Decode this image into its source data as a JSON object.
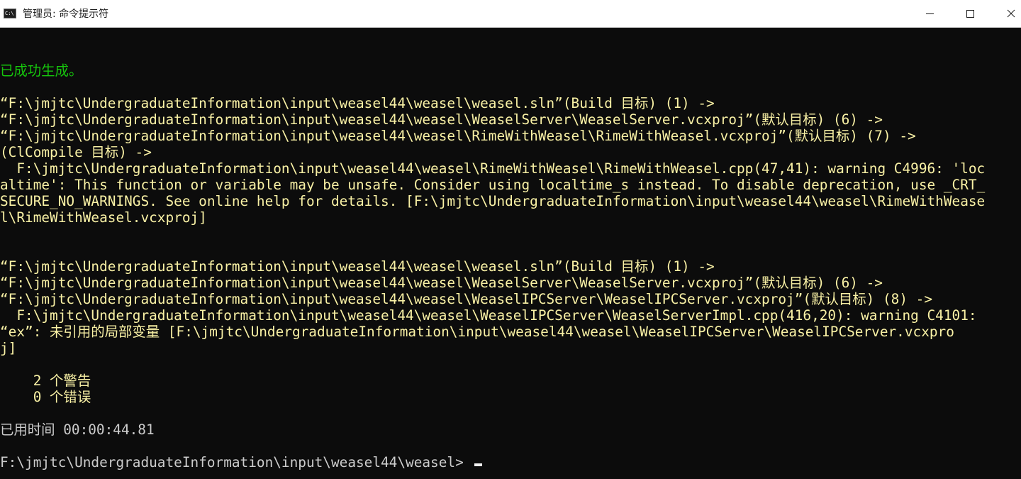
{
  "window": {
    "title": "管理员: 命令提示符",
    "icon": "cmd-icon",
    "controls": {
      "minimize": "minimize-icon",
      "maximize": "maximize-icon",
      "close": "close-icon"
    }
  },
  "colors": {
    "background": "#0c0c0c",
    "success": "#16c60c",
    "warning": "#f9f1a5",
    "default_text": "#cccccc"
  },
  "console": {
    "lines": [
      {
        "text": "已成功生成。",
        "color": "green"
      },
      {
        "text": "",
        "color": "gray"
      },
      {
        "text": "“F:\\jmjtc\\UndergraduateInformation\\input\\weasel44\\weasel\\weasel.sln”(Build 目标) (1) ->",
        "color": "yellow"
      },
      {
        "text": "“F:\\jmjtc\\UndergraduateInformation\\input\\weasel44\\weasel\\WeaselServer\\WeaselServer.vcxproj”(默认目标) (6) ->",
        "color": "yellow"
      },
      {
        "text": "“F:\\jmjtc\\UndergraduateInformation\\input\\weasel44\\weasel\\RimeWithWeasel\\RimeWithWeasel.vcxproj”(默认目标) (7) ->",
        "color": "yellow"
      },
      {
        "text": "(ClCompile 目标) ->",
        "color": "yellow"
      },
      {
        "text": "  F:\\jmjtc\\UndergraduateInformation\\input\\weasel44\\weasel\\RimeWithWeasel\\RimeWithWeasel.cpp(47,41): warning C4996: 'loc",
        "color": "yellow"
      },
      {
        "text": "altime': This function or variable may be unsafe. Consider using localtime_s instead. To disable deprecation, use _CRT_",
        "color": "yellow"
      },
      {
        "text": "SECURE_NO_WARNINGS. See online help for details. [F:\\jmjtc\\UndergraduateInformation\\input\\weasel44\\weasel\\RimeWithWease",
        "color": "yellow"
      },
      {
        "text": "l\\RimeWithWeasel.vcxproj]",
        "color": "yellow"
      },
      {
        "text": "",
        "color": "gray"
      },
      {
        "text": "",
        "color": "gray"
      },
      {
        "text": "“F:\\jmjtc\\UndergraduateInformation\\input\\weasel44\\weasel\\weasel.sln”(Build 目标) (1) ->",
        "color": "yellow"
      },
      {
        "text": "“F:\\jmjtc\\UndergraduateInformation\\input\\weasel44\\weasel\\WeaselServer\\WeaselServer.vcxproj”(默认目标) (6) ->",
        "color": "yellow"
      },
      {
        "text": "“F:\\jmjtc\\UndergraduateInformation\\input\\weasel44\\weasel\\WeaselIPCServer\\WeaselIPCServer.vcxproj”(默认目标) (8) ->",
        "color": "yellow"
      },
      {
        "text": "  F:\\jmjtc\\UndergraduateInformation\\input\\weasel44\\weasel\\WeaselIPCServer\\WeaselServerImpl.cpp(416,20): warning C4101:",
        "color": "yellow"
      },
      {
        "text": "“ex”: 未引用的局部变量 [F:\\jmjtc\\UndergraduateInformation\\input\\weasel44\\weasel\\WeaselIPCServer\\WeaselIPCServer.vcxpro",
        "color": "yellow"
      },
      {
        "text": "j]",
        "color": "yellow"
      },
      {
        "text": "",
        "color": "gray"
      },
      {
        "text": "    2 个警告",
        "color": "yellow"
      },
      {
        "text": "    0 个错误",
        "color": "yellow"
      },
      {
        "text": "",
        "color": "gray"
      },
      {
        "text": "已用时间 00:00:44.81",
        "color": "gray"
      },
      {
        "text": "",
        "color": "gray"
      },
      {
        "text": "F:\\jmjtc\\UndergraduateInformation\\input\\weasel44\\weasel>",
        "color": "gray"
      }
    ]
  }
}
